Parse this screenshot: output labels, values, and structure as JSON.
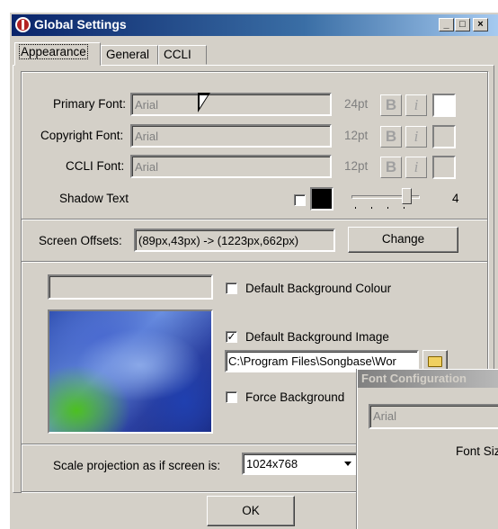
{
  "window": {
    "title": "Global Settings",
    "min": "_",
    "max": "□",
    "close": "×"
  },
  "tabs": [
    {
      "label": "Appearance"
    },
    {
      "label": "General"
    },
    {
      "label": "CCLI"
    }
  ],
  "fonts": {
    "primary": {
      "label": "Primary Font:",
      "value": "Arial",
      "size": "24pt"
    },
    "copyright": {
      "label": "Copyright Font:",
      "value": "Arial",
      "size": "12pt"
    },
    "ccli": {
      "label": "CCLI Font:",
      "value": "Arial",
      "size": "12pt"
    },
    "bold_glyph": "B",
    "italic_glyph": "i"
  },
  "shadow": {
    "label": "Shadow Text",
    "value": "4",
    "color": "#000000"
  },
  "offsets": {
    "label": "Screen Offsets:",
    "value": "(89px,43px) -> (1223px,662px)",
    "button": "Change"
  },
  "background": {
    "default_colour": {
      "label": "Default Background Colour",
      "checked": false
    },
    "default_image": {
      "label": "Default Background Image",
      "checked": true
    },
    "image_path": "C:\\Program Files\\Songbase\\Wor",
    "force": {
      "label": "Force Background",
      "checked": false
    }
  },
  "scale": {
    "label": "Scale projection as if screen is:",
    "value": "1024x768"
  },
  "ok_label": "OK",
  "popup": {
    "title": "Font Configuration",
    "font_value": "Arial",
    "size_label": "Font Siz"
  }
}
